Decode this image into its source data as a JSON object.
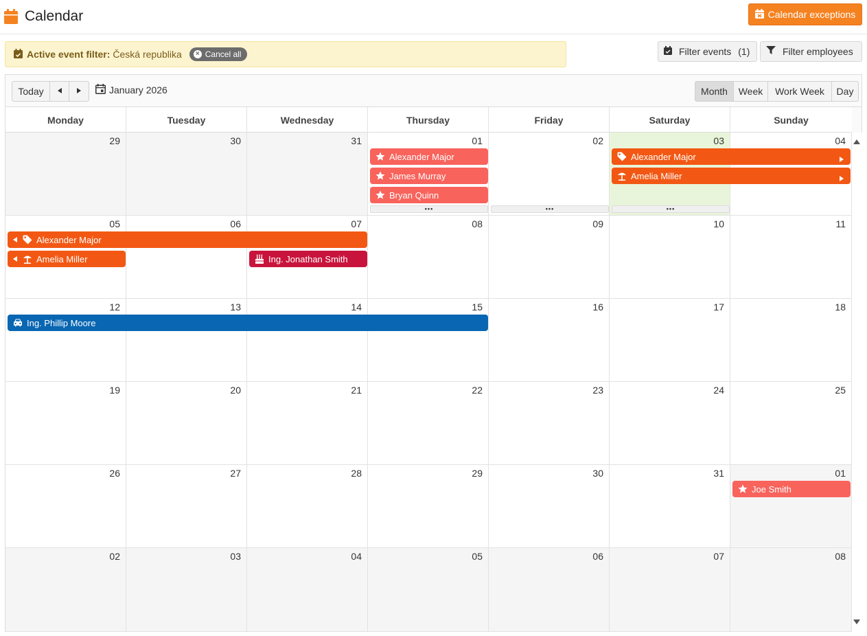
{
  "header": {
    "title": "Calendar",
    "exceptions_label": "Calendar exceptions",
    "accent": "#f58220"
  },
  "filter": {
    "label": "Active event filter:",
    "value": "Česká republika",
    "cancel_label": "Cancel all",
    "filter_events_label": "Filter events",
    "filter_events_count": "(1)",
    "filter_employees_label": "Filter employees"
  },
  "toolbar": {
    "today_label": "Today",
    "date_label": "January 2026",
    "views": [
      "Month",
      "Week",
      "Work Week",
      "Day"
    ],
    "active_view": "Month"
  },
  "days": [
    "Monday",
    "Tuesday",
    "Wednesday",
    "Thursday",
    "Friday",
    "Saturday",
    "Sunday"
  ],
  "weeks": [
    [
      "29",
      "30",
      "31",
      "01",
      "02",
      "03",
      "04"
    ],
    [
      "05",
      "06",
      "07",
      "08",
      "09",
      "10",
      "11"
    ],
    [
      "12",
      "13",
      "14",
      "15",
      "16",
      "17",
      "18"
    ],
    [
      "19",
      "20",
      "21",
      "22",
      "23",
      "24",
      "25"
    ],
    [
      "26",
      "27",
      "28",
      "29",
      "30",
      "31",
      "01"
    ],
    [
      "02",
      "03",
      "04",
      "05",
      "06",
      "07",
      "08"
    ]
  ],
  "events": [
    {
      "name": "Alexander Major",
      "icon": "star-icon",
      "color": "pink"
    },
    {
      "name": "James Murray",
      "icon": "star-icon",
      "color": "pink"
    },
    {
      "name": "Bryan Quinn",
      "icon": "star-icon",
      "color": "pink"
    },
    {
      "name": "Alexander Major",
      "icon": "tag-icon",
      "color": "orange"
    },
    {
      "name": "Amelia Miller",
      "icon": "beach-umbrella-icon",
      "color": "orange"
    },
    {
      "name": "Alexander Major",
      "icon": "tag-icon",
      "color": "orange"
    },
    {
      "name": "Amelia Miller",
      "icon": "beach-umbrella-icon",
      "color": "orange"
    },
    {
      "name": "Ing. Jonathan Smith",
      "icon": "birthday-cake-icon",
      "color": "crimson"
    },
    {
      "name": "Ing. Phillip Moore",
      "icon": "car-icon",
      "color": "blue"
    },
    {
      "name": "Joe Smith",
      "icon": "star-icon",
      "color": "pink"
    }
  ],
  "colors": {
    "pink": "#f8635c",
    "orange": "#f25814",
    "crimson": "#c8143c",
    "blue": "#0866b2",
    "today": "#e9f5da"
  }
}
